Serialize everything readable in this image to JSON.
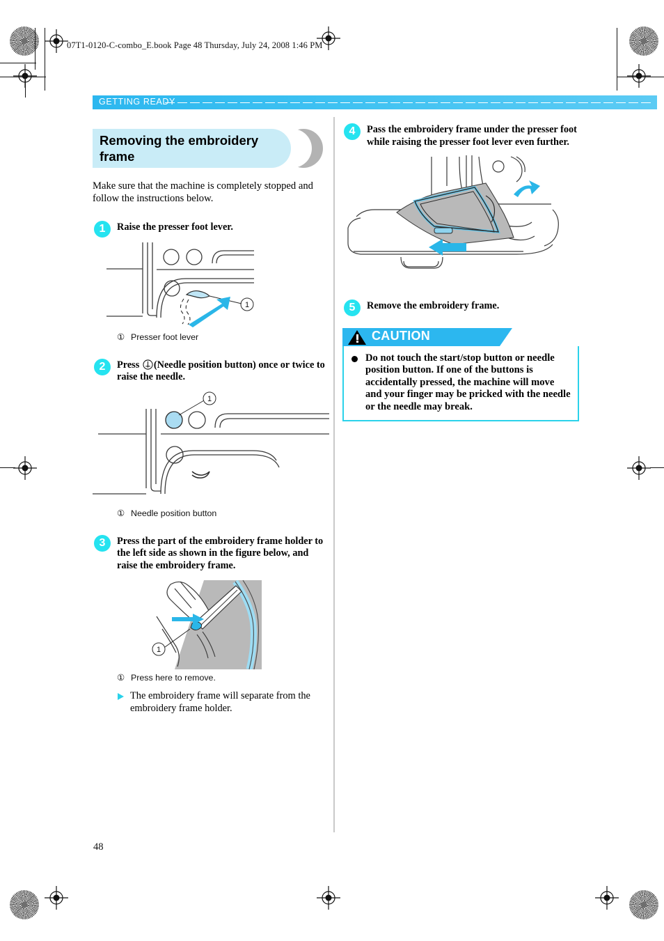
{
  "document": {
    "running_head": "07T1-0120-C-combo_E.book  Page 48  Thursday, July 24, 2008  1:46 PM",
    "section_label": "GETTING READY",
    "page_number": "48",
    "accent_cyan": "#25e3f0",
    "accent_blue": "#2cb7ef",
    "title_pill_color": "#c9ecf7"
  },
  "left_column": {
    "title": "Removing the embroidery frame",
    "intro": "Make sure that the machine is completely stopped and follow the instructions below.",
    "steps": [
      {
        "number": "1",
        "text": "Raise the presser foot lever.",
        "caption_marker": "①",
        "caption": "Presser foot lever"
      },
      {
        "number": "2",
        "text_before_icon": "Press ",
        "icon": "needle-position-button-icon",
        "text_after_icon": "(Needle position button) once or twice to raise the needle.",
        "caption_marker": "①",
        "caption": "Needle position button"
      },
      {
        "number": "3",
        "text": "Press the part of the embroidery frame holder to the left side as shown in the figure below, and raise the embroidery frame.",
        "caption_marker": "①",
        "caption": "Press here to remove.",
        "note": "The embroidery frame will separate from the embroidery frame holder."
      }
    ]
  },
  "right_column": {
    "steps": [
      {
        "number": "4",
        "text": "Pass the embroidery frame under the presser foot while raising the presser foot lever even further."
      },
      {
        "number": "5",
        "text": "Remove the embroidery frame."
      }
    ],
    "caution": {
      "label": "CAUTION",
      "items": [
        "Do not touch the start/stop button or needle position button. If one of the buttons is accidentally pressed, the machine will move and your finger may be pricked with the needle or the needle may break."
      ]
    }
  }
}
